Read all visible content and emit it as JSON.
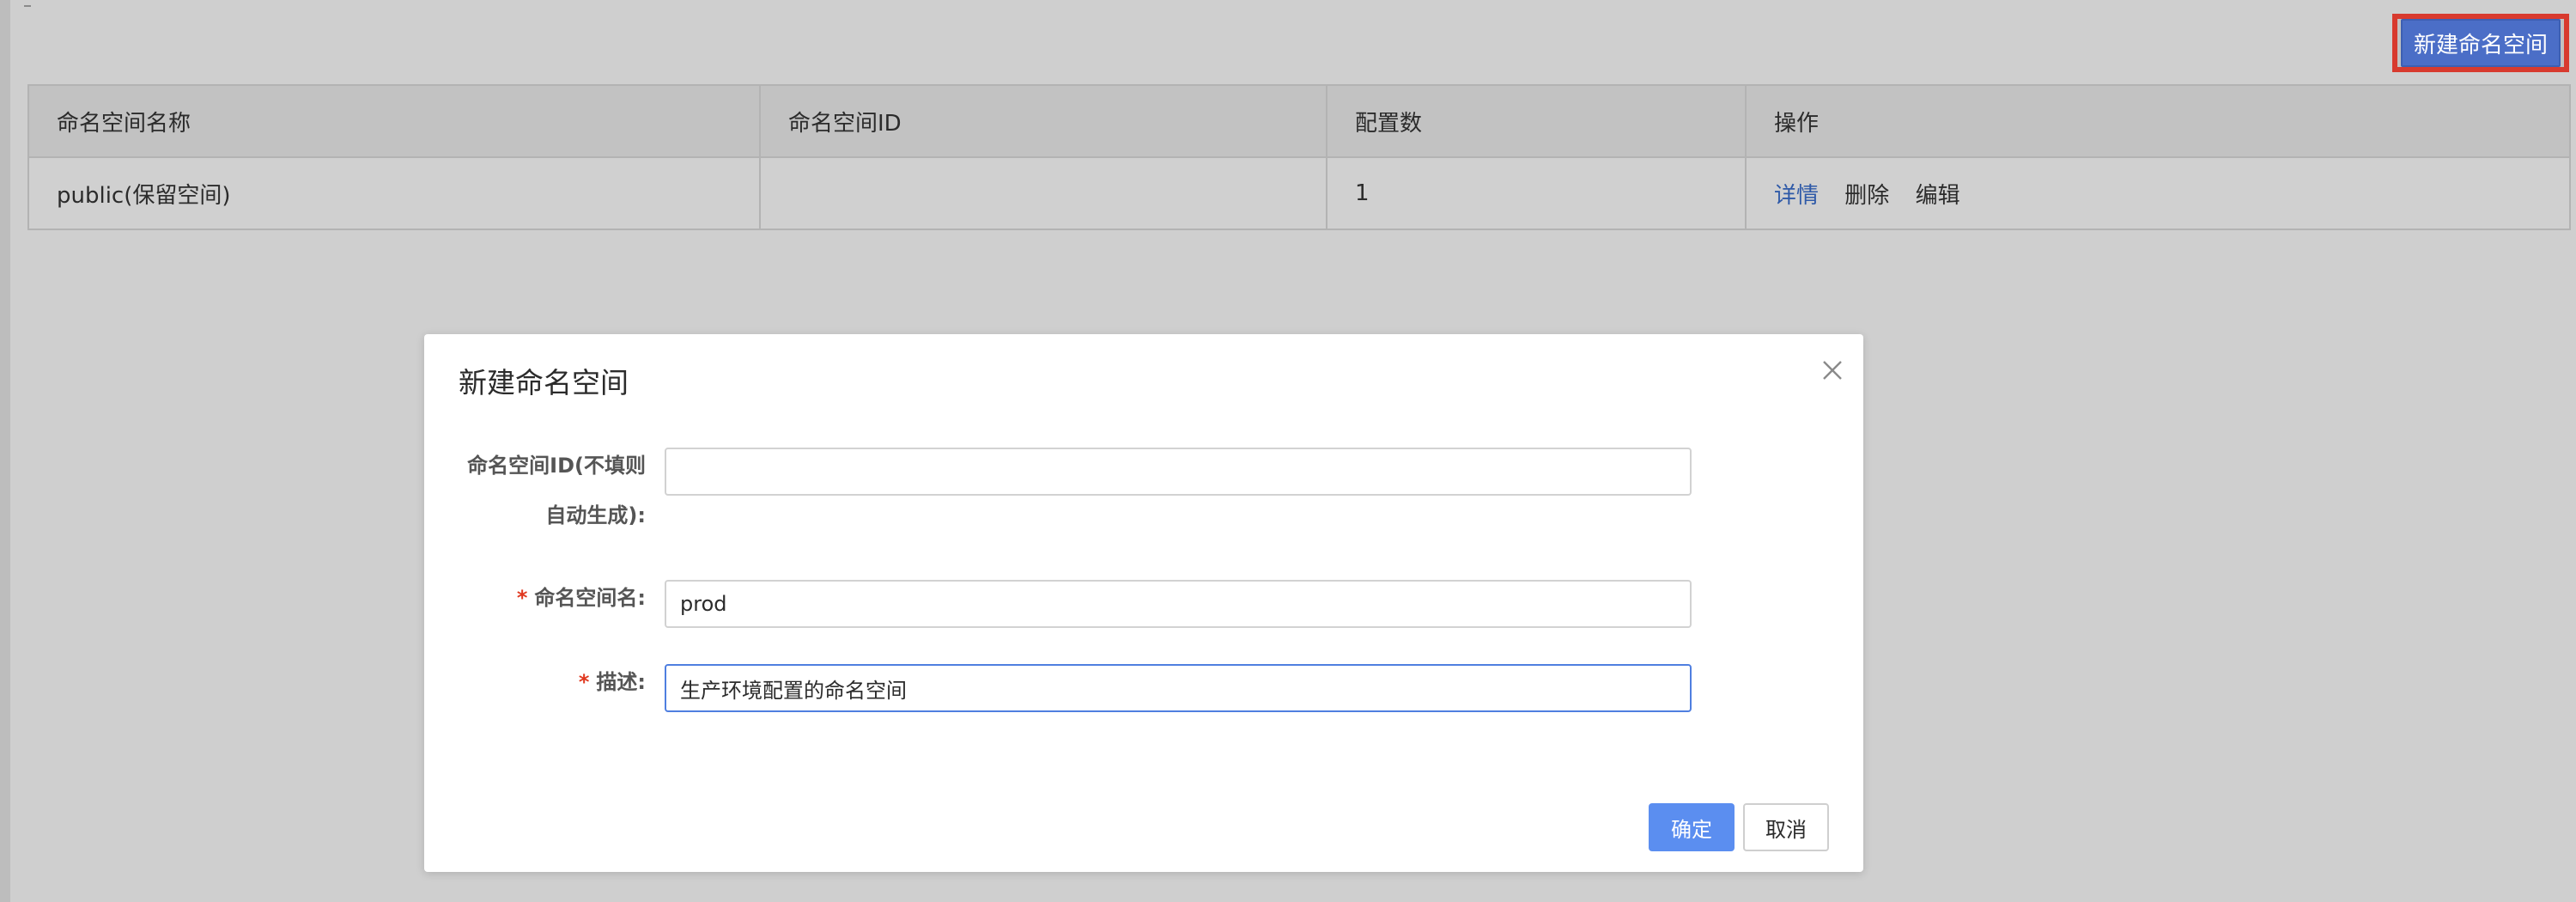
{
  "toolbar": {
    "new_namespace_label": "新建命名空间"
  },
  "table": {
    "headers": [
      "命名空间名称",
      "命名空间ID",
      "配置数",
      "操作"
    ],
    "rows": [
      {
        "name": "public(保留空间)",
        "id": "",
        "config_count": "1",
        "actions": {
          "detail": "详情",
          "delete": "删除",
          "edit": "编辑"
        }
      }
    ]
  },
  "modal": {
    "title": "新建命名空间",
    "fields": {
      "namespace_id": {
        "label_line1": "命名空间ID(不填则",
        "label_line2": "自动生成):",
        "value": ""
      },
      "namespace_name": {
        "required_mark": "*",
        "label": "命名空间名:",
        "value": "prod"
      },
      "description": {
        "required_mark": "*",
        "label": "描述:",
        "value": "生产环境配置的命名空间"
      }
    },
    "confirm_label": "确定",
    "cancel_label": "取消"
  },
  "colors": {
    "primary": "#5b8ef0",
    "highlight_frame": "#d83a2e",
    "link": "#2f5aa8",
    "required": "#e0381f"
  }
}
